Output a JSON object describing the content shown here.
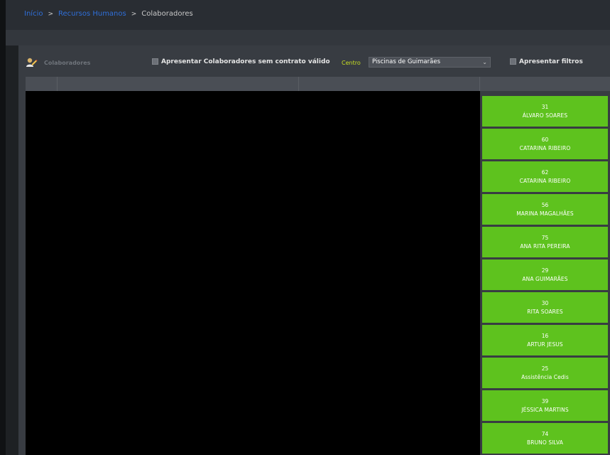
{
  "breadcrumb": {
    "home": "Início",
    "section": "Recursos Humanos",
    "current": "Colaboradores",
    "separator": ">"
  },
  "toolbar": {
    "title": "Colaboradores",
    "title_icon": "user-edit-icon",
    "show_without_contract_label": "Apresentar Colaboradores sem contrato válido",
    "centro_label": "Centro",
    "centro_selected": "Piscinas de Guimarães",
    "show_filters_label": "Apresentar filtros"
  },
  "colors": {
    "card_green": "#5ec21e",
    "link_blue": "#2f6fd9",
    "centro_label_yellow": "#c9df23"
  },
  "employees": [
    {
      "number": "31",
      "name": "ÁLVARO SOARES"
    },
    {
      "number": "60",
      "name": "CATARINA RIBEIRO"
    },
    {
      "number": "62",
      "name": "CATARINA RIBEIRO"
    },
    {
      "number": "56",
      "name": "MARINA MAGALHÃES"
    },
    {
      "number": "75",
      "name": "ANA RITA PEREIRA"
    },
    {
      "number": "29",
      "name": "ANA GUIMARÃES"
    },
    {
      "number": "30",
      "name": "RITA SOARES"
    },
    {
      "number": "16",
      "name": "ARTUR JESUS"
    },
    {
      "number": "25",
      "name": "Assistência Cedis"
    },
    {
      "number": "39",
      "name": "JÉSSICA MARTINS"
    },
    {
      "number": "74",
      "name": "BRUNO SILVA"
    }
  ]
}
